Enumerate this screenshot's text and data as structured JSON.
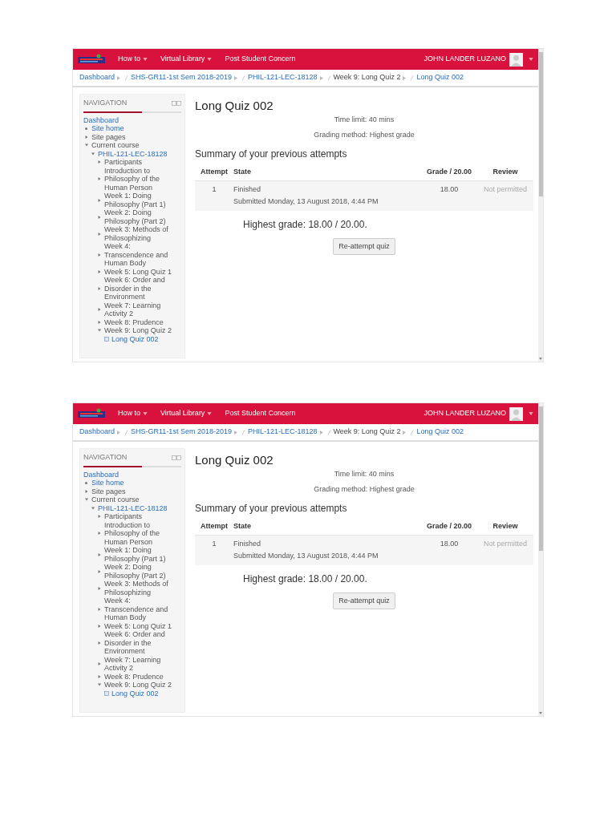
{
  "screenshots": [
    {
      "header": {
        "menu": [
          {
            "label": "How to",
            "caret": true
          },
          {
            "label": "Virtual Library",
            "caret": true
          },
          {
            "label": "Post Student Concern",
            "caret": false
          }
        ],
        "user": "JOHN LANDER LUZANO"
      },
      "breadcrumb": [
        {
          "label": "Dashboard",
          "link": true
        },
        {
          "label": "SHS-GR11-1st Sem 2018-2019",
          "link": true
        },
        {
          "label": "PHIL-121-LEC-18128",
          "link": true
        },
        {
          "label": "Week 9: Long Quiz 2",
          "link": false
        },
        {
          "label": "Long Quiz 002",
          "link": true
        }
      ],
      "navigation": {
        "title": "NAVIGATION",
        "tree": [
          {
            "label": "Dashboard",
            "kind": "plain",
            "link": true,
            "children": [
              {
                "label": "Site home",
                "kind": "bullet",
                "link": true
              },
              {
                "label": "Site pages",
                "kind": "branch",
                "link": false,
                "expanded": false
              },
              {
                "label": "Current course",
                "kind": "branch",
                "link": false,
                "expanded": true,
                "children": [
                  {
                    "label": "PHIL-121-LEC-18128",
                    "kind": "branch",
                    "link": true,
                    "expanded": true,
                    "children": [
                      {
                        "label": "Participants",
                        "kind": "branch",
                        "link": false,
                        "expanded": false
                      },
                      {
                        "label": "Introduction to Philosophy of the Human Person",
                        "kind": "branch",
                        "link": false,
                        "expanded": false
                      },
                      {
                        "label": "Week 1: Doing Philosophy (Part 1)",
                        "kind": "branch",
                        "link": false,
                        "expanded": false
                      },
                      {
                        "label": "Week 2: Doing Philosophy (Part 2)",
                        "kind": "branch",
                        "link": false,
                        "expanded": false
                      },
                      {
                        "label": "Week 3: Methods of Philosophizing",
                        "kind": "branch",
                        "link": false,
                        "expanded": false
                      },
                      {
                        "label": "Week 4: Transcendence and Human Body",
                        "kind": "branch",
                        "link": false,
                        "expanded": false
                      },
                      {
                        "label": "Week 5: Long Quiz 1",
                        "kind": "branch",
                        "link": false,
                        "expanded": false
                      },
                      {
                        "label": "Week 6: Order and Disorder in the Environment",
                        "kind": "branch",
                        "link": false,
                        "expanded": false
                      },
                      {
                        "label": "Week 7: Learning Activity 2",
                        "kind": "branch",
                        "link": false,
                        "expanded": false
                      },
                      {
                        "label": "Week 8: Prudence",
                        "kind": "branch",
                        "link": false,
                        "expanded": false
                      },
                      {
                        "label": "Week 9: Long Quiz 2",
                        "kind": "branch",
                        "link": false,
                        "expanded": true,
                        "children": [
                          {
                            "label": "Long Quiz 002",
                            "kind": "quiz",
                            "link": true
                          }
                        ]
                      }
                    ]
                  }
                ]
              }
            ]
          }
        ]
      },
      "main": {
        "title": "Long Quiz 002",
        "info": [
          "Time limit: 40 mins",
          "Grading method: Highest grade"
        ],
        "summary_heading": "Summary of your previous attempts",
        "table": {
          "columns": [
            "Attempt",
            "State",
            "Grade / 20.00",
            "Review"
          ],
          "rows": [
            {
              "attempt": "1",
              "state": "Finished",
              "submitted": "Submitted Monday, 13 August 2018, 4:44 PM",
              "grade": "18.00",
              "review": "Not permitted"
            }
          ]
        },
        "highest_grade": "Highest grade: 18.00 / 20.00.",
        "button": "Re-attempt quiz"
      }
    },
    {
      "header": {
        "menu": [
          {
            "label": "How to",
            "caret": true
          },
          {
            "label": "Virtual Library",
            "caret": true
          },
          {
            "label": "Post Student Concern",
            "caret": false
          }
        ],
        "user": "JOHN LANDER LUZANO"
      },
      "breadcrumb": [
        {
          "label": "Dashboard",
          "link": true
        },
        {
          "label": "SHS-GR11-1st Sem 2018-2019",
          "link": true
        },
        {
          "label": "PHIL-121-LEC-18128",
          "link": true
        },
        {
          "label": "Week 9: Long Quiz 2",
          "link": false
        },
        {
          "label": "Long Quiz 002",
          "link": true
        }
      ],
      "navigation": {
        "title": "NAVIGATION",
        "tree": [
          {
            "label": "Dashboard",
            "kind": "plain",
            "link": true,
            "children": [
              {
                "label": "Site home",
                "kind": "bullet",
                "link": true
              },
              {
                "label": "Site pages",
                "kind": "branch",
                "link": false,
                "expanded": false
              },
              {
                "label": "Current course",
                "kind": "branch",
                "link": false,
                "expanded": true,
                "children": [
                  {
                    "label": "PHIL-121-LEC-18128",
                    "kind": "branch",
                    "link": true,
                    "expanded": true,
                    "children": [
                      {
                        "label": "Participants",
                        "kind": "branch",
                        "link": false,
                        "expanded": false
                      },
                      {
                        "label": "Introduction to Philosophy of the Human Person",
                        "kind": "branch",
                        "link": false,
                        "expanded": false
                      },
                      {
                        "label": "Week 1: Doing Philosophy (Part 1)",
                        "kind": "branch",
                        "link": false,
                        "expanded": false
                      },
                      {
                        "label": "Week 2: Doing Philosophy (Part 2)",
                        "kind": "branch",
                        "link": false,
                        "expanded": false
                      },
                      {
                        "label": "Week 3: Methods of Philosophizing",
                        "kind": "branch",
                        "link": false,
                        "expanded": false
                      },
                      {
                        "label": "Week 4: Transcendence and Human Body",
                        "kind": "branch",
                        "link": false,
                        "expanded": false
                      },
                      {
                        "label": "Week 5: Long Quiz 1",
                        "kind": "branch",
                        "link": false,
                        "expanded": false
                      },
                      {
                        "label": "Week 6: Order and Disorder in the Environment",
                        "kind": "branch",
                        "link": false,
                        "expanded": false
                      },
                      {
                        "label": "Week 7: Learning Activity 2",
                        "kind": "branch",
                        "link": false,
                        "expanded": false
                      },
                      {
                        "label": "Week 8: Prudence",
                        "kind": "branch",
                        "link": false,
                        "expanded": false
                      },
                      {
                        "label": "Week 9: Long Quiz 2",
                        "kind": "branch",
                        "link": false,
                        "expanded": true,
                        "children": [
                          {
                            "label": "Long Quiz 002",
                            "kind": "quiz",
                            "link": true
                          }
                        ]
                      }
                    ]
                  }
                ]
              }
            ]
          }
        ]
      },
      "main": {
        "title": "Long Quiz 002",
        "info": [
          "Time limit: 40 mins",
          "Grading method: Highest grade"
        ],
        "summary_heading": "Summary of your previous attempts",
        "table": {
          "columns": [
            "Attempt",
            "State",
            "Grade / 20.00",
            "Review"
          ],
          "rows": [
            {
              "attempt": "1",
              "state": "Finished",
              "submitted": "Submitted Monday, 13 August 2018, 4:44 PM",
              "grade": "18.00",
              "review": "Not permitted"
            }
          ]
        },
        "highest_grade": "Highest grade: 18.00 / 20.00.",
        "button": "Re-attempt quiz"
      }
    }
  ]
}
